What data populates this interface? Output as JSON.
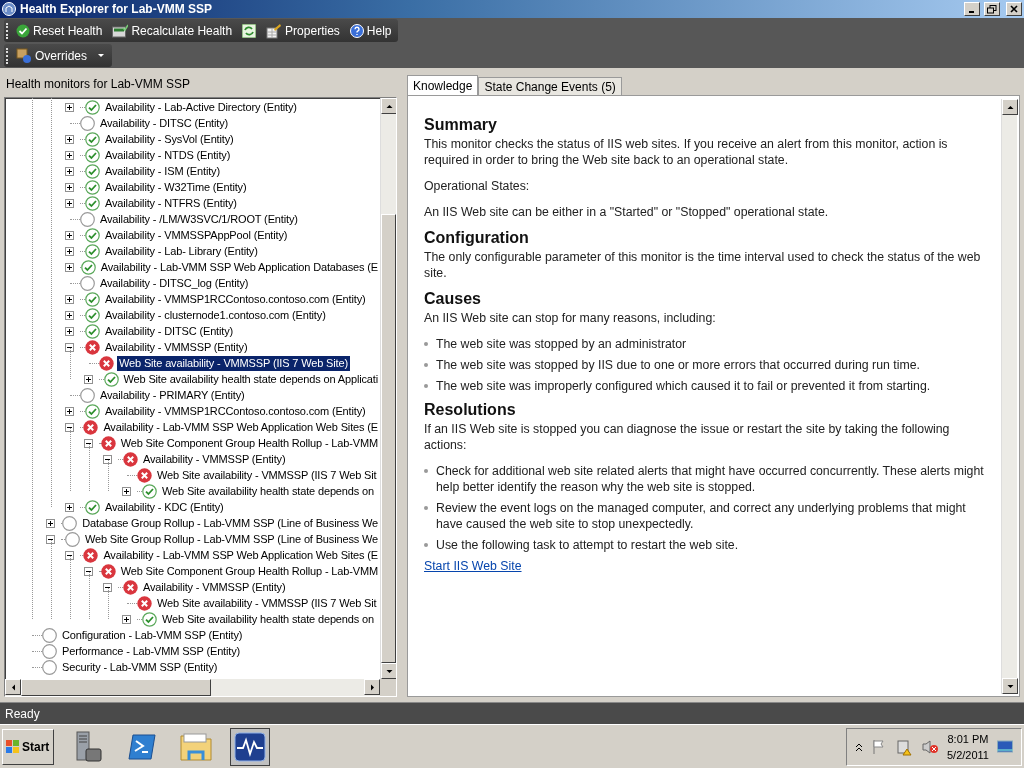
{
  "window": {
    "title": "Health Explorer for Lab-VMM SSP"
  },
  "toolbar": [
    {
      "kind": "reset",
      "label": "Reset Health"
    },
    {
      "kind": "recalculate",
      "label": "Recalculate Health"
    },
    {
      "kind": "refresh"
    },
    {
      "kind": "properties",
      "label": "Properties"
    },
    {
      "kind": "help",
      "label": "Help"
    }
  ],
  "toolbar2": [
    {
      "kind": "overrides",
      "label": "Overrides"
    }
  ],
  "tree": {
    "title": "Health monitors for Lab-VMM SSP",
    "items": [
      {
        "children": [
          {
            "children": [
              {
                "label": "Availability - Lab-Active Directory (Entity)",
                "kind": "ok",
                "expanded": false,
                "selected": false
              },
              {
                "label": "Availability - DITSC (Entity)",
                "kind": "none",
                "selected": false
              },
              {
                "label": "Availability - SysVol (Entity)",
                "kind": "ok",
                "expanded": false,
                "selected": false
              },
              {
                "label": "Availability - NTDS (Entity)",
                "kind": "ok",
                "expanded": false,
                "selected": false
              },
              {
                "label": "Availability - ISM (Entity)",
                "kind": "ok",
                "expanded": false,
                "selected": false
              },
              {
                "label": "Availability - W32Time (Entity)",
                "kind": "ok",
                "expanded": false,
                "selected": false
              },
              {
                "label": "Availability - NTFRS (Entity)",
                "kind": "ok",
                "expanded": false,
                "selected": false
              },
              {
                "label": "Availability - /LM/W3SVC/1/ROOT (Entity)",
                "kind": "none",
                "selected": false
              },
              {
                "label": "Availability - VMMSSPAppPool (Entity)",
                "kind": "ok",
                "expanded": false,
                "selected": false
              },
              {
                "label": "Availability - Lab- Library (Entity)",
                "kind": "ok",
                "expanded": false,
                "selected": false
              },
              {
                "label": "Availability - Lab-VMM SSP Web Application Databases (E",
                "kind": "ok",
                "expanded": false,
                "selected": false
              },
              {
                "label": "Availability - DITSC_log (Entity)",
                "kind": "none",
                "selected": false
              },
              {
                "label": "Availability - VMMSP1RCContoso.contoso.com (Entity)",
                "kind": "ok",
                "expanded": false,
                "selected": false
              },
              {
                "label": "Availability - clusternode1.contoso.com (Entity)",
                "kind": "ok",
                "expanded": false,
                "selected": false
              },
              {
                "label": "Availability - DITSC (Entity)",
                "kind": "ok",
                "expanded": false,
                "selected": false
              },
              {
                "label": "Availability - VMMSSP (Entity)",
                "kind": "error",
                "expanded": true,
                "selected": false,
                "children": [
                  {
                    "label": "Web Site availability - VMMSSP (IIS 7 Web Site)",
                    "kind": "error",
                    "selected": true
                  },
                  {
                    "label": "Web Site availability health state depends on Applicati",
                    "kind": "ok",
                    "expanded": false,
                    "selected": false
                  }
                ]
              },
              {
                "label": "Availability - PRIMARY (Entity)",
                "kind": "none",
                "selected": false
              },
              {
                "label": "Availability - VMMSP1RCContoso.contoso.com (Entity)",
                "kind": "ok",
                "expanded": false,
                "selected": false
              },
              {
                "label": "Availability - Lab-VMM SSP Web Application Web Sites (E",
                "kind": "error",
                "expanded": true,
                "selected": false,
                "children": [
                  {
                    "label": "Web Site Component Group Health Rollup - Lab-VMM",
                    "kind": "error",
                    "expanded": true,
                    "selected": false,
                    "children": [
                      {
                        "label": "Availability - VMMSSP (Entity)",
                        "kind": "error",
                        "expanded": true,
                        "selected": false,
                        "children": [
                          {
                            "label": "Web Site availability - VMMSSP (IIS 7 Web Sit",
                            "kind": "error",
                            "selected": false
                          },
                          {
                            "label": "Web Site availability health state depends on",
                            "kind": "ok",
                            "expanded": false,
                            "selected": false
                          }
                        ]
                      }
                    ]
                  }
                ]
              },
              {
                "label": "Availability - KDC (Entity)",
                "kind": "ok",
                "expanded": false,
                "selected": false
              }
            ]
          },
          {
            "label": "Database Group Rollup - Lab-VMM SSP (Line of Business We",
            "kind": "none",
            "expanded": false,
            "selected": false
          },
          {
            "label": "Web Site Group Rollup - Lab-VMM SSP (Line of Business We",
            "kind": "none",
            "expanded": true,
            "selected": false,
            "children": [
              {
                "label": "Availability - Lab-VMM SSP Web Application Web Sites (E",
                "kind": "error",
                "expanded": true,
                "selected": false,
                "children": [
                  {
                    "label": "Web Site Component Group Health Rollup - Lab-VMM",
                    "kind": "error",
                    "expanded": true,
                    "selected": false,
                    "children": [
                      {
                        "label": "Availability - VMMSSP (Entity)",
                        "kind": "error",
                        "expanded": true,
                        "selected": false,
                        "children": [
                          {
                            "label": "Web Site availability - VMMSSP (IIS 7 Web Sit",
                            "kind": "error",
                            "selected": false
                          },
                          {
                            "label": "Web Site availability health state depends on",
                            "kind": "ok",
                            "expanded": false,
                            "selected": false
                          }
                        ]
                      }
                    ]
                  }
                ]
              }
            ]
          }
        ]
      },
      {
        "label": "Configuration - Lab-VMM SSP (Entity)",
        "kind": "none",
        "selected": false
      },
      {
        "label": "Performance - Lab-VMM SSP (Entity)",
        "kind": "none",
        "selected": false
      },
      {
        "label": "Security - Lab-VMM SSP (Entity)",
        "kind": "none",
        "selected": false
      }
    ]
  },
  "tabs": [
    {
      "label": "Knowledge",
      "selected": true
    },
    {
      "label": "State Change Events (5)",
      "selected": false
    }
  ],
  "knowledge": [
    {
      "kind": "heading",
      "text": "Summary"
    },
    {
      "kind": "paragraph",
      "text": "This monitor checks the status of IIS web sites. If you receive an alert from this monitor, action is required in order to bring the Web site back to an operational state."
    },
    {
      "kind": "paragraph",
      "text": "Operational States:"
    },
    {
      "kind": "paragraph",
      "text": "An IIS Web site can be either in a \"Started\" or \"Stopped\" operational state."
    },
    {
      "kind": "heading",
      "text": "Configuration"
    },
    {
      "kind": "paragraph",
      "text": "The only configurable parameter of this monitor is the time interval used to check the status of the web site."
    },
    {
      "kind": "heading",
      "text": "Causes"
    },
    {
      "kind": "paragraph",
      "text": "An IIS Web site can stop for many reasons, including:"
    },
    {
      "kind": "bullet",
      "text": "The web site was stopped by an administrator"
    },
    {
      "kind": "bullet",
      "text": "The web site was stopped by IIS due to one or more errors that occurred during run time."
    },
    {
      "kind": "bullet",
      "text": "The web site was improperly configured which caused it to fail or prevented it from starting."
    },
    {
      "kind": "heading",
      "text": "Resolutions"
    },
    {
      "kind": "paragraph",
      "text": "If an IIS Web site is stopped you can diagnose the issue or restart the site by taking the following actions:"
    },
    {
      "kind": "bullet",
      "text": "Check for additional web site related alerts that might have occurred concurrently. These alerts might help better identify the reason why the web site is stopped."
    },
    {
      "kind": "bullet",
      "text": "Review the event logs on the managed computer, and correct any underlying problems that might have caused the web site to stop unexpectedly."
    },
    {
      "kind": "bullet",
      "text": "Use the following task to attempt to restart the web site."
    },
    {
      "kind": "link",
      "text": "Start IIS Web Site"
    }
  ],
  "status_bar": "Ready",
  "taskbar": {
    "start": "Start",
    "apps": [
      {
        "kind": "server",
        "selected": false
      },
      {
        "kind": "shell",
        "selected": false
      },
      {
        "kind": "folder",
        "selected": false
      },
      {
        "kind": "monitor",
        "selected": true
      }
    ],
    "clock": {
      "time": "8:01 PM",
      "date": "5/2/2011"
    }
  }
}
